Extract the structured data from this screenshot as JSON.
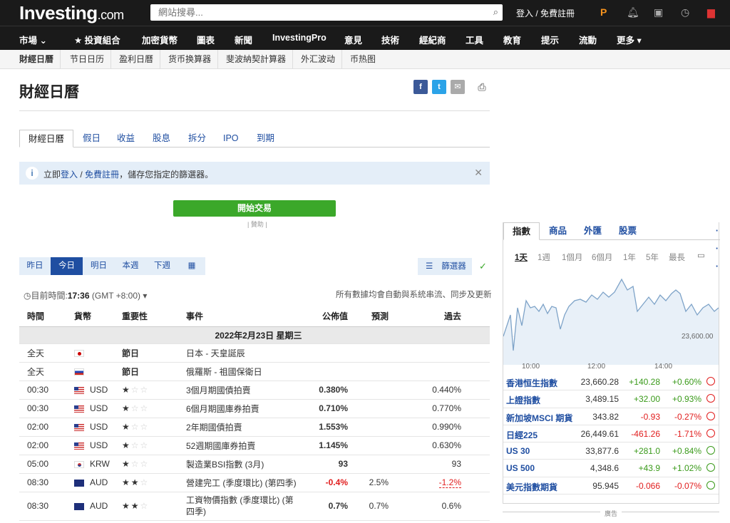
{
  "header": {
    "logo_main": "Investing",
    "logo_suffix": ".com",
    "search_placeholder": "網站搜尋...",
    "login_text": "登入 / 免費註冊"
  },
  "nav": {
    "items": [
      "市場 ⌄",
      "★ 投資組合",
      "加密貨幣",
      "圖表",
      "新聞",
      "InvestingPro",
      "意見",
      "技術",
      "經紀商",
      "工具",
      "教育",
      "提示",
      "流動",
      "更多 ▾"
    ]
  },
  "subnav": {
    "items": [
      "財經日曆",
      "节日日历",
      "盈利日曆",
      "货币换算器",
      "斐波納契計算器",
      "外汇波动",
      "币热图"
    ]
  },
  "page": {
    "title": "財經日曆"
  },
  "tabs": [
    "財經日曆",
    "假日",
    "收益",
    "股息",
    "拆分",
    "IPO",
    "到期"
  ],
  "info_bar": {
    "prefix": "立即",
    "login": "登入",
    "sep": " / ",
    "register": "免費註冊",
    "suffix": "，儲存您指定的篩選器。"
  },
  "trade_button": "開始交易",
  "sponsored": "| 贊助 |",
  "day_buttons": [
    "昨日",
    "今日",
    "明日",
    "本週",
    "下週"
  ],
  "filter_label": "篩選器",
  "current_time": {
    "label": "目前時間:",
    "time": "17:36",
    "tz": "(GMT +8:00)"
  },
  "note": "所有數據均會自動與系統串流、同步及更新",
  "table": {
    "headers": [
      "時間",
      "貨幣",
      "重要性",
      "事件",
      "公佈值",
      "預測",
      "過去"
    ],
    "date_row": "2022年2月23日  星期三",
    "rows": [
      {
        "time": "全天",
        "currency": "",
        "importance": "節日",
        "event": "日本 - 天皇誕辰",
        "actual": "",
        "forecast": "",
        "previous": ""
      },
      {
        "time": "全天",
        "currency": "",
        "importance": "節日",
        "event": "俄羅斯 - 祖國保衛日",
        "actual": "",
        "forecast": "",
        "previous": ""
      },
      {
        "time": "00:30",
        "currency": "USD",
        "importance": "★☆☆",
        "event": "3個月期國債拍賣",
        "actual": "0.380%",
        "forecast": "",
        "previous": "0.440%"
      },
      {
        "time": "00:30",
        "currency": "USD",
        "importance": "★☆☆",
        "event": "6個月期國庫券拍賣",
        "actual": "0.710%",
        "forecast": "",
        "previous": "0.770%"
      },
      {
        "time": "02:00",
        "currency": "USD",
        "importance": "★☆☆",
        "event": "2年期國債拍賣",
        "actual": "1.553%",
        "forecast": "",
        "previous": "0.990%"
      },
      {
        "time": "02:00",
        "currency": "USD",
        "importance": "★☆☆",
        "event": "52週期國庫券拍賣",
        "actual": "1.145%",
        "forecast": "",
        "previous": "0.630%"
      },
      {
        "time": "05:00",
        "currency": "KRW",
        "importance": "★☆☆",
        "event": "製造業BSI指數 (3月)",
        "actual": "93",
        "forecast": "",
        "previous": "93"
      },
      {
        "time": "08:30",
        "currency": "AUD",
        "importance": "★★☆",
        "event": "營建完工 (季度環比) (第四季)",
        "actual": "-0.4%",
        "forecast": "2.5%",
        "previous": "-1.2%"
      },
      {
        "time": "08:30",
        "currency": "AUD",
        "importance": "★★☆",
        "event": "工資物價指數 (季度環比) (第四季)",
        "actual": "0.7%",
        "forecast": "0.7%",
        "previous": "0.6%"
      }
    ]
  },
  "sidebar": {
    "tabs": [
      "指數",
      "商品",
      "外匯",
      "股票"
    ],
    "periods": [
      "1天",
      "1週",
      "1個月",
      "6個月",
      "1年",
      "5年",
      "最長"
    ],
    "chart_labels": {
      "y": "23,600.00",
      "x": [
        "10:00",
        "12:00",
        "14:00"
      ]
    },
    "indices": [
      {
        "name": "香港恒生指數",
        "price": "23,660.28",
        "change": "+140.28",
        "pct": "+0.60%"
      },
      {
        "name": "上證指數",
        "price": "3,489.15",
        "change": "+32.00",
        "pct": "+0.93%"
      },
      {
        "name": "新加坡MSCI 期貨",
        "price": "343.82",
        "change": "-0.93",
        "pct": "-0.27%"
      },
      {
        "name": "日經225",
        "price": "26,449.61",
        "change": "-461.26",
        "pct": "-1.71%"
      },
      {
        "name": "US 30",
        "price": "33,877.6",
        "change": "+281.0",
        "pct": "+0.84%"
      },
      {
        "name": "US 500",
        "price": "4,348.6",
        "change": "+43.9",
        "pct": "+1.02%"
      },
      {
        "name": "美元指數期貨",
        "price": "95.945",
        "change": "-0.066",
        "pct": "-0.07%"
      }
    ]
  },
  "ad_label": "廣告",
  "colors": {
    "nav_bg": "#1a1a1a",
    "link": "#1f4ea1",
    "green": "#3ba82a",
    "red": "#e11d1d"
  }
}
